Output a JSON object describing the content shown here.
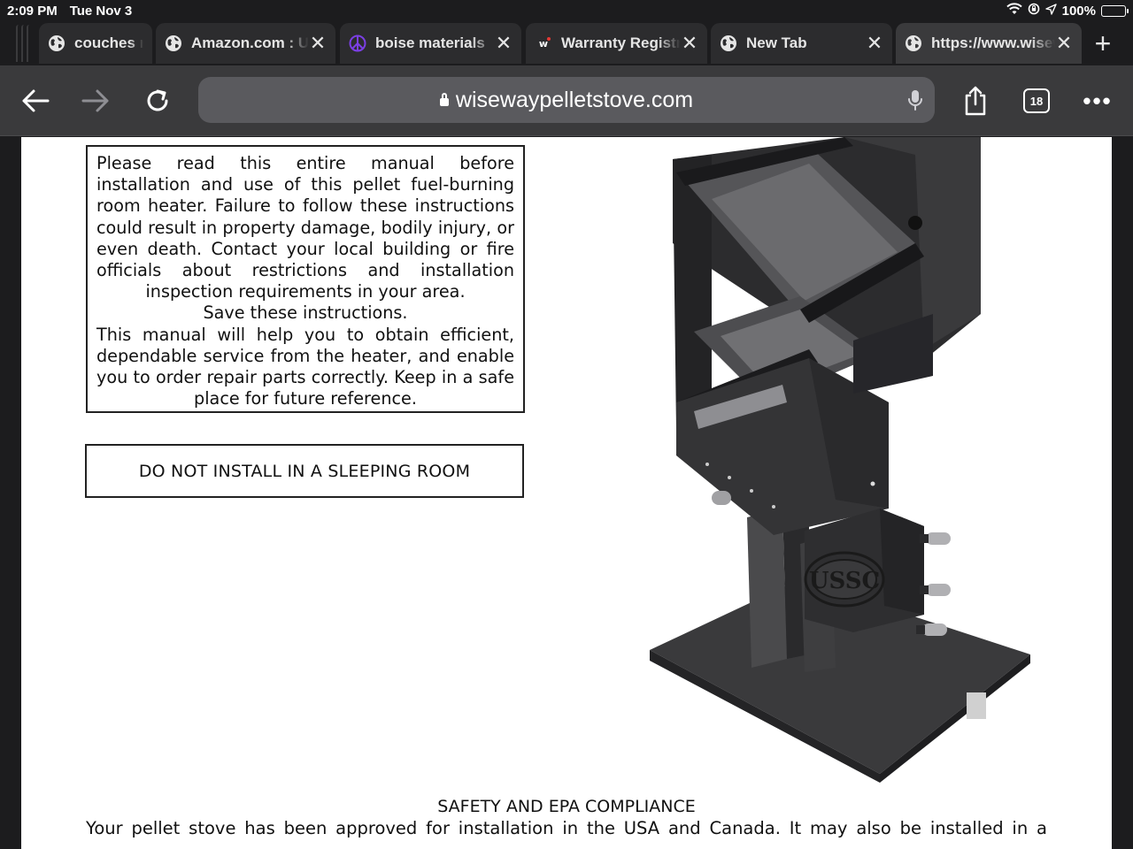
{
  "status_bar": {
    "time": "2:09 PM",
    "date": "Tue Nov 3",
    "battery": "100%",
    "battery_level": 1.0
  },
  "tabs": [
    {
      "title": "couches r",
      "favicon": "globe-icon"
    },
    {
      "title": "Amazon.com : Unbranded",
      "favicon": "globe-icon"
    },
    {
      "title": "boise materials",
      "favicon": "peace-icon"
    },
    {
      "title": "Warranty Registration",
      "favicon": "w-logo-icon"
    },
    {
      "title": "New Tab",
      "favicon": "globe-icon"
    },
    {
      "title": "https://www.wisewaypelletstove.com",
      "favicon": "globe-icon",
      "active": true
    }
  ],
  "toolbar": {
    "url": "wisewaypelletstove.com",
    "tab_count": "18"
  },
  "page": {
    "notice": {
      "intro": "Please read this entire manual before installation and use of this pellet fuel-burning room heater. Failure to follow these instructions could result in property damage, bodily injury, or even death. Contact your local building or fire officials about restrictions and installation inspection requirements in your area.",
      "save": "Save these instructions.",
      "outro": "This manual will help you to obtain efficient, dependable service from the heater, and enable you to order repair parts correctly. Keep in a safe place for future reference."
    },
    "warning": "DO NOT INSTALL IN A SLEEPING ROOM",
    "logo_text": "USSC",
    "safety_title": "SAFETY AND EPA COMPLIANCE",
    "safety_body": "Your pellet stove has been approved for installation in the USA and Canada. It may also be installed in a"
  }
}
